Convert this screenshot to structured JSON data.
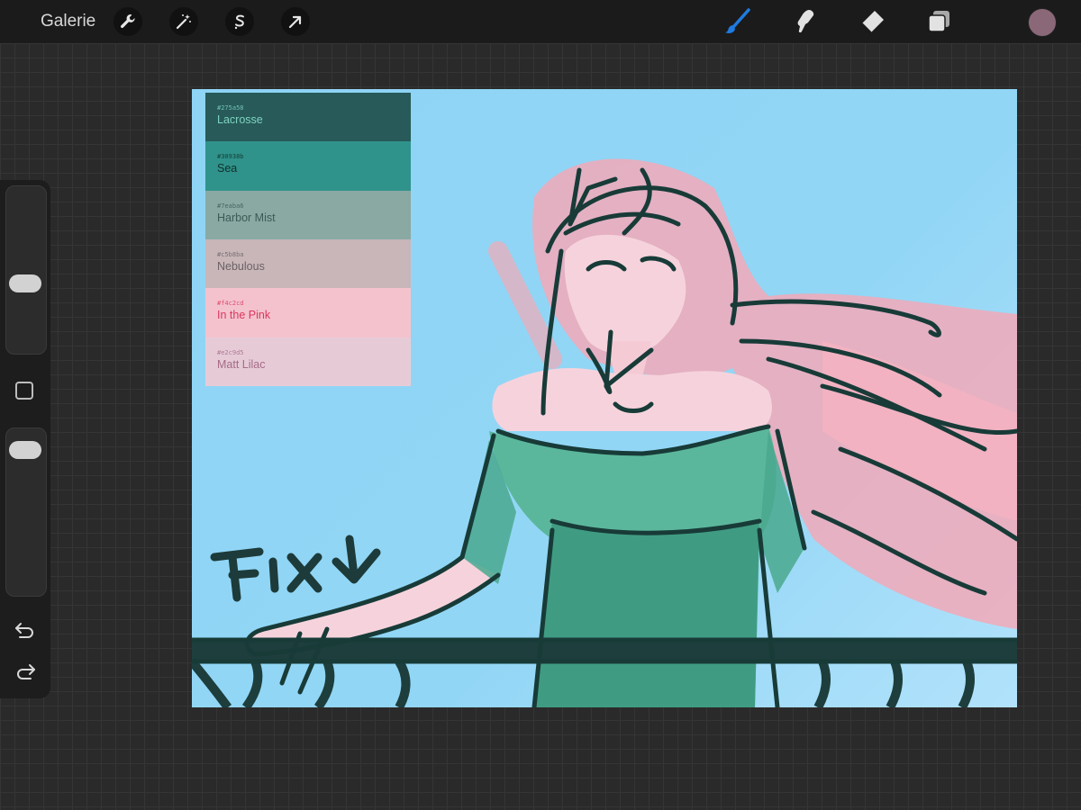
{
  "topbar": {
    "gallery_label": "Galerie",
    "left_tools": [
      "wrench-icon",
      "magic-wand-icon",
      "selection-s-icon",
      "move-arrow-icon"
    ],
    "right_tools": [
      "brush-icon",
      "smudge-icon",
      "eraser-icon",
      "layers-icon"
    ],
    "active_tool": "brush-icon",
    "accent_color": "#1f7be0",
    "current_color": "#8a6878"
  },
  "sidebar": {
    "brush_size_level": 0.4,
    "opacity_level": 0.95,
    "icons": [
      "modify-square-icon",
      "undo-icon",
      "redo-icon"
    ]
  },
  "palette": {
    "swatches": [
      {
        "hex": "#275a58",
        "name": "Lacrosse",
        "color": "#275a58",
        "text_color": "#7fd3c4"
      },
      {
        "hex": "#30938b",
        "name": "Sea",
        "color": "#30938b",
        "text_color": "#0f2e2a"
      },
      {
        "hex": "#7eaba6",
        "name": "Harbor Mist",
        "color": "#8aa9a3",
        "text_color": "#3c5a57"
      },
      {
        "hex": "#c5b8ba",
        "name": "Nebulous",
        "color": "#c8b6b9",
        "text_color": "#6b6266"
      },
      {
        "hex": "#f4c2cd",
        "name": "In the Pink",
        "color": "#f4c2cd",
        "text_color": "#d9375f"
      },
      {
        "hex": "#e2c9d5",
        "name": "Matt Lilac",
        "color": "#e6cbd7",
        "text_color": "#a56a86"
      }
    ]
  }
}
